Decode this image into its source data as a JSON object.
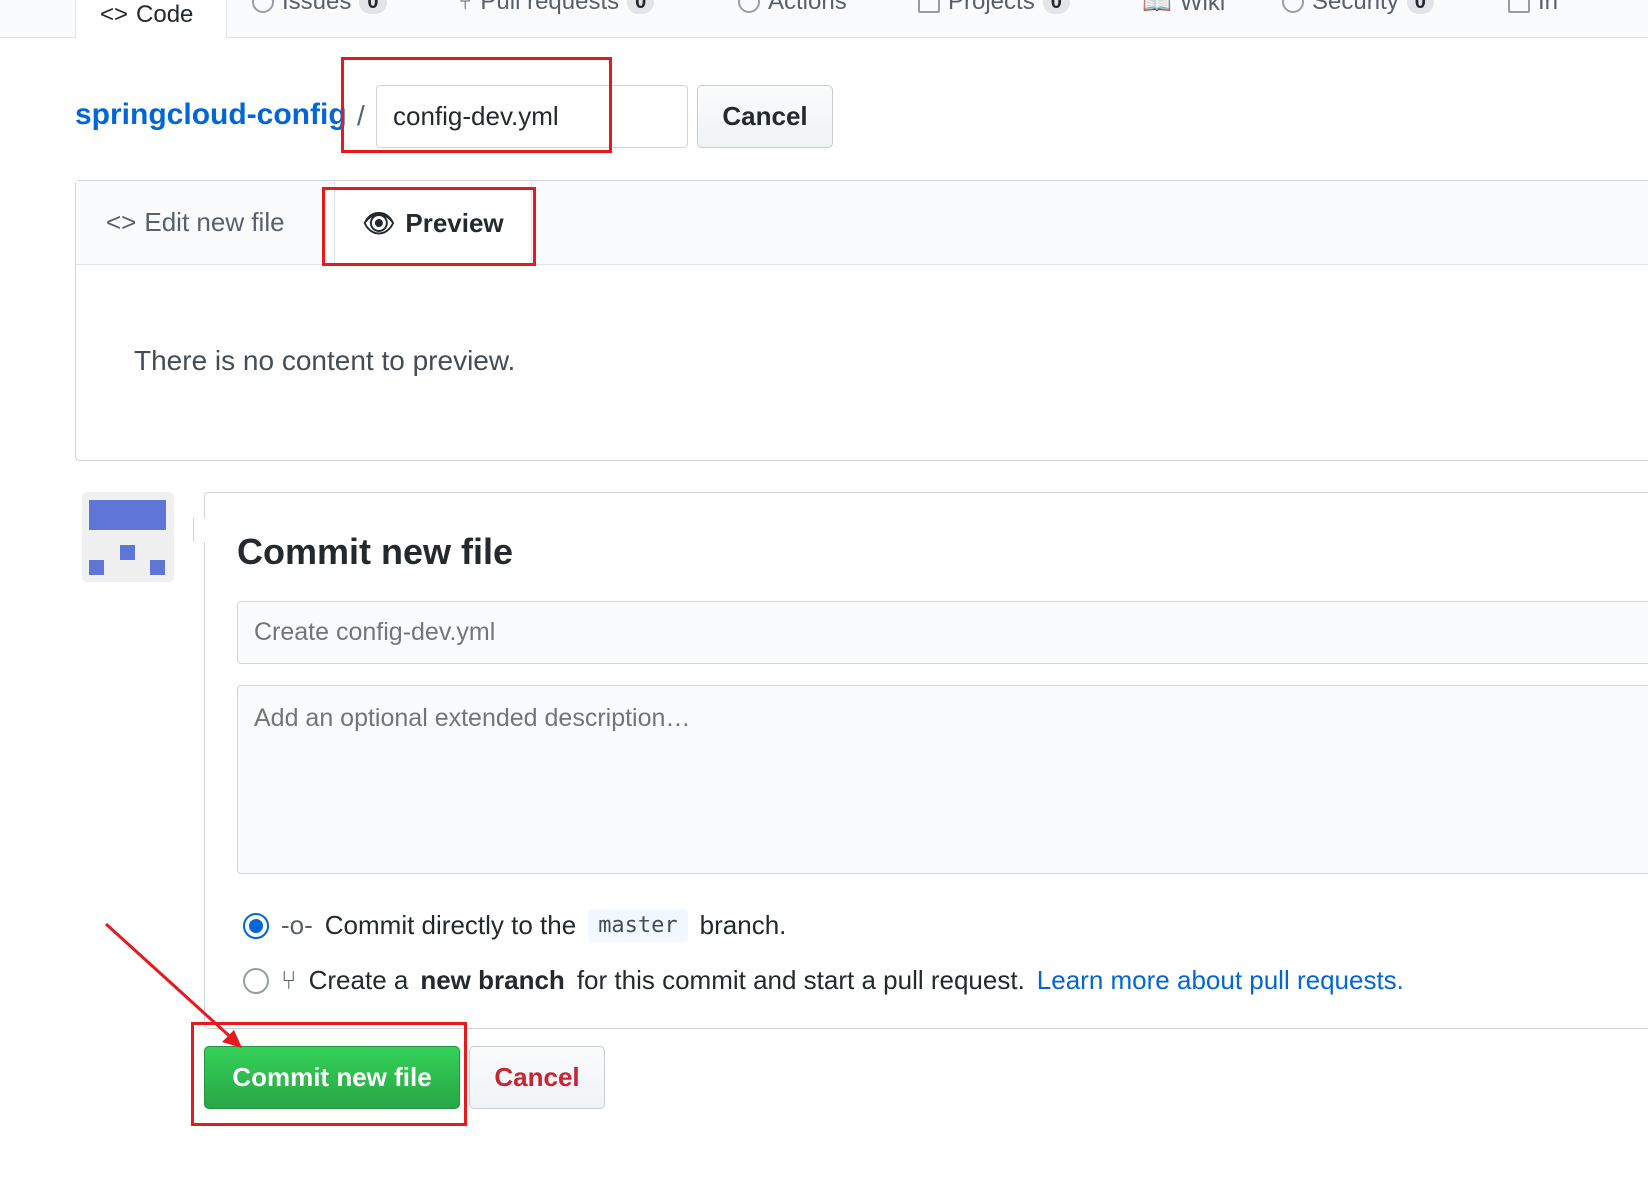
{
  "nav": {
    "tabs": [
      {
        "label": "Code",
        "icon": "code-icon"
      },
      {
        "label": "Issues",
        "count": "0",
        "icon": "issue-icon"
      },
      {
        "label": "Pull requests",
        "count": "0",
        "icon": "pull-request-icon"
      },
      {
        "label": "Actions",
        "icon": "play-icon"
      },
      {
        "label": "Projects",
        "count": "0",
        "icon": "project-icon"
      },
      {
        "label": "Wiki",
        "icon": "book-icon"
      },
      {
        "label": "Security",
        "count": "0",
        "icon": "shield-icon"
      },
      {
        "label": "In",
        "icon": "graph-icon"
      }
    ]
  },
  "breadcrumb": {
    "repo": "springcloud-config",
    "separator": "/",
    "filename": "config-dev.yml",
    "cancel": "Cancel"
  },
  "editor": {
    "tabs": [
      {
        "label": "Edit new file"
      },
      {
        "label": "Preview"
      }
    ],
    "preview_text": "There is no content to preview."
  },
  "commit": {
    "title": "Commit new file",
    "summary_placeholder": "Create config-dev.yml",
    "description_placeholder": "Add an optional extended description…",
    "option_direct": {
      "before": "Commit directly to the",
      "branch": "master",
      "after": "branch.",
      "selected": true
    },
    "option_new": {
      "before": "Create a",
      "bold": "new branch",
      "after": "for this commit and start a pull request.",
      "link": "Learn more about pull requests.",
      "selected": false
    },
    "submit": "Commit new file",
    "cancel": "Cancel"
  },
  "colors": {
    "accent": "#0366d6",
    "submit": "#2cbe4e",
    "annotation": "#e8191c",
    "avatar": "#5e76d6"
  }
}
